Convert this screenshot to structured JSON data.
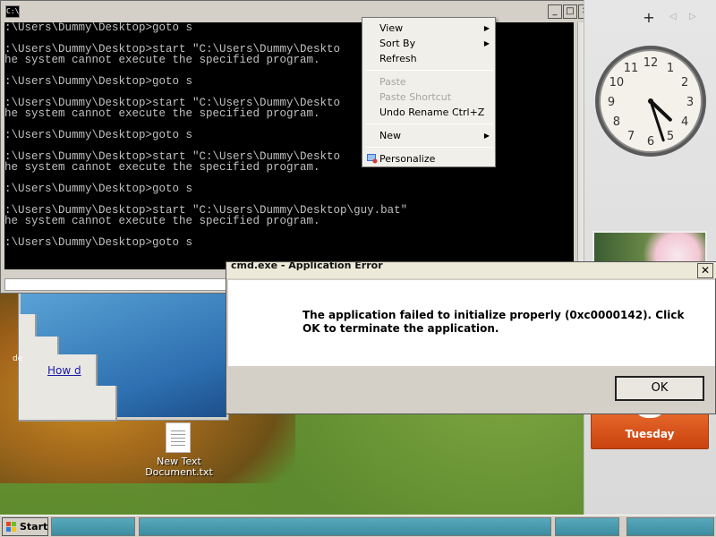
{
  "cmd": {
    "icon_text": "C:\\",
    "minimize": "_",
    "maximize": "□",
    "close": "✕",
    "console_lines": [
      ":\\Users\\Dummy\\Desktop>goto s",
      "",
      ":\\Users\\Dummy\\Desktop>start \"C:\\Users\\Dummy\\Deskto",
      "he system cannot execute the specified program.",
      "",
      ":\\Users\\Dummy\\Desktop>goto s",
      "",
      ":\\Users\\Dummy\\Desktop>start \"C:\\Users\\Dummy\\Deskto",
      "he system cannot execute the specified program.",
      "",
      ":\\Users\\Dummy\\Desktop>goto s",
      "",
      ":\\Users\\Dummy\\Desktop>start \"C:\\Users\\Dummy\\Deskto",
      "he system cannot execute the specified program.",
      "",
      ":\\Users\\Dummy\\Desktop>goto s",
      "",
      ":\\Users\\Dummy\\Desktop>start \"C:\\Users\\Dummy\\Desktop\\guy.bat\"",
      "he system cannot execute the specified program.",
      "",
      ":\\Users\\Dummy\\Desktop>goto s"
    ]
  },
  "context_menu": {
    "view": "View",
    "sort_by": "Sort By",
    "refresh": "Refresh",
    "paste": "Paste",
    "paste_shortcut": "Paste Shortcut",
    "undo_rename": "Undo Rename",
    "undo_shortcut": "Ctrl+Z",
    "new": "New",
    "personalize": "Personalize"
  },
  "sidebar": {
    "add": "+",
    "prev": "◁",
    "next": "▷",
    "clock": {
      "hour": 4,
      "minute": 27
    },
    "calendar_day": "Tuesday"
  },
  "error_dialog": {
    "title": "cmd.exe - Application Error",
    "close": "✕",
    "message_line1": "The application failed to initialize properly (0xc0000142). Click",
    "message_line2": "OK to terminate the application.",
    "ok": "OK"
  },
  "background_window": {
    "link": "How d",
    "side_label": "de"
  },
  "desktop_icon": {
    "label_line1": "New Text",
    "label_line2": "Document.txt"
  },
  "taskbar": {
    "start": "Start"
  },
  "colors": {
    "console_bg": "#000000",
    "console_fg": "#c0c0c0",
    "calendar": "#d9521c"
  }
}
